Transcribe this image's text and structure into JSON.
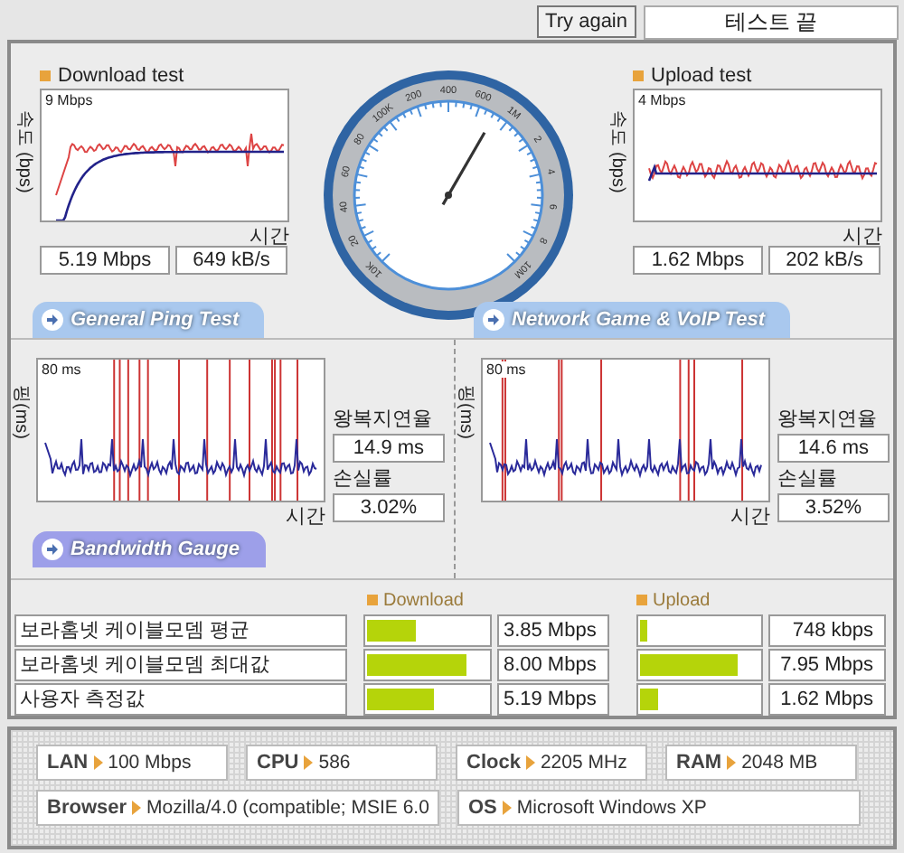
{
  "top_bar": {
    "button": "Try again",
    "status": "테스트 끝"
  },
  "download": {
    "title": "Download test",
    "y_label": "속도 (bps)",
    "max_label": "9 Mbps",
    "x_label": "시간",
    "speed": "5.19 Mbps",
    "rate": "649 kB/s"
  },
  "gauge": {
    "labels": [
      "10K",
      "20",
      "40",
      "60",
      "80",
      "100K",
      "200",
      "400",
      "600",
      "1M",
      "2",
      "4",
      "6",
      "8",
      "10M"
    ]
  },
  "upload": {
    "title": "Upload test",
    "y_label": "속도 (bps)",
    "max_label": "4 Mbps",
    "x_label": "시간",
    "speed": "1.62 Mbps",
    "rate": "202 kB/s"
  },
  "section_tabs": [
    "General Ping Test",
    "Network Game & VoIP Test"
  ],
  "ping_tests": [
    {
      "y_label": "핑(ms)",
      "max_label": "80 ms",
      "x_label": "시간",
      "latency_label": "왕복지연율",
      "latency": "14.9 ms",
      "loss_label": "손실률",
      "loss": "3.02%"
    },
    {
      "y_label": "핑(ms)",
      "max_label": "80 ms",
      "x_label": "시간",
      "latency_label": "왕복지연율",
      "latency": "14.6 ms",
      "loss_label": "손실률",
      "loss": "3.52%"
    }
  ],
  "bandwidth_tab": "Bandwidth Gauge",
  "bandwidth": {
    "download_heading": "Download",
    "upload_heading": "Upload",
    "rows": [
      {
        "label": "보라홈넷 케이블모뎀 평균",
        "download": {
          "level": 0.4,
          "value": "3.85 Mbps"
        },
        "upload": {
          "level": 0.06,
          "value": "748 kbps"
        }
      },
      {
        "label": "보라홈넷 케이블모뎀 최대값",
        "download": {
          "level": 0.83,
          "value": "8.00 Mbps"
        },
        "upload": {
          "level": 0.82,
          "value": "7.95 Mbps"
        }
      },
      {
        "label": "사용자 측정값",
        "download": {
          "level": 0.55,
          "value": "5.19 Mbps"
        },
        "upload": {
          "level": 0.16,
          "value": "1.62 Mbps"
        }
      }
    ]
  },
  "system_info": [
    [
      {
        "label": "LAN",
        "value": "100 Mbps"
      },
      {
        "label": "CPU",
        "value": "586"
      },
      {
        "label": "Clock",
        "value": "2205 MHz"
      },
      {
        "label": "RAM",
        "value": "2048 MB"
      }
    ],
    [
      {
        "label": "Browser",
        "value": "Mozilla/4.0 (compatible; MSIE 6.0"
      },
      {
        "label": "OS",
        "value": "Microsoft Windows XP"
      }
    ]
  ]
}
